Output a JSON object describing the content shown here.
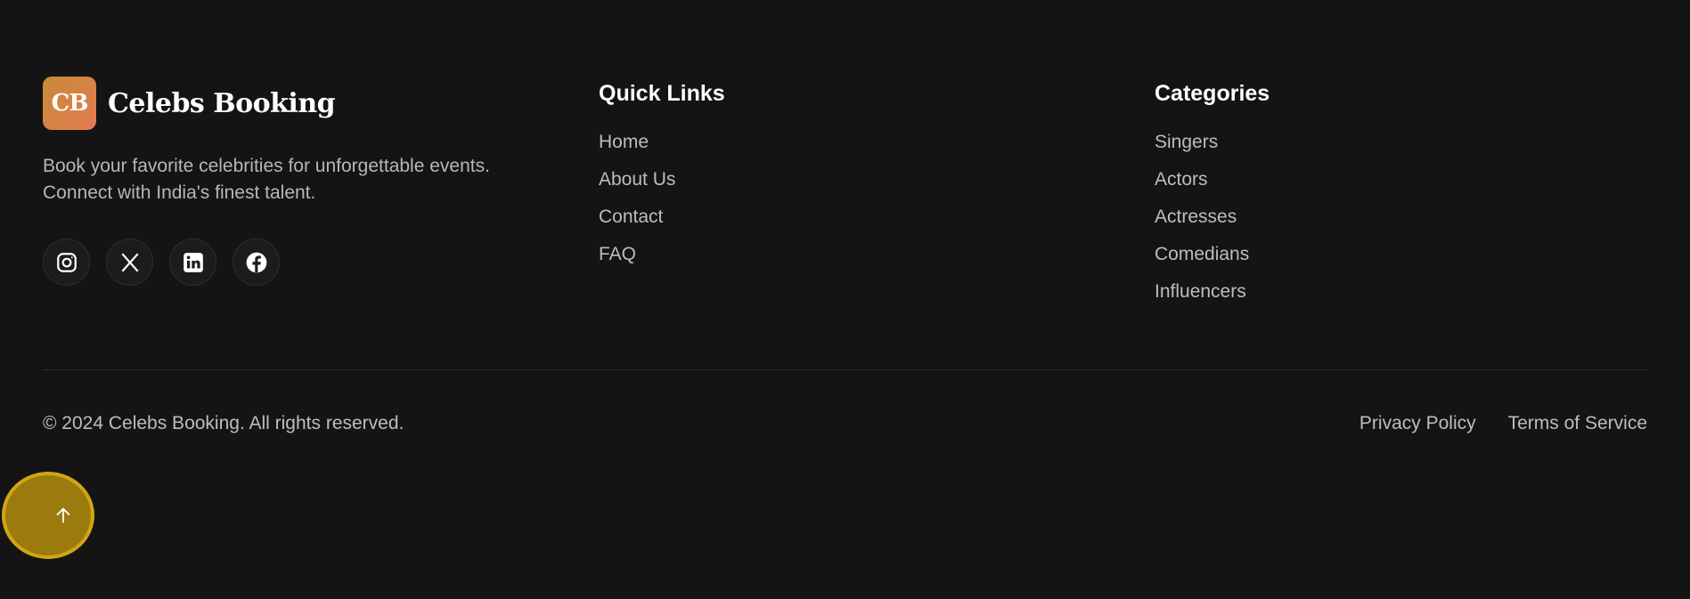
{
  "brand": {
    "logo_text": "CB",
    "name": "Celebs Booking",
    "tagline": "Book your favorite celebrities for unforgettable events. Connect with India's finest talent."
  },
  "socials": [
    {
      "icon": "instagram-icon"
    },
    {
      "icon": "x-twitter-icon"
    },
    {
      "icon": "linkedin-icon"
    },
    {
      "icon": "facebook-icon"
    }
  ],
  "quick_links": {
    "heading": "Quick Links",
    "items": [
      "Home",
      "About Us",
      "Contact",
      "FAQ"
    ]
  },
  "categories": {
    "heading": "Categories",
    "items": [
      "Singers",
      "Actors",
      "Actresses",
      "Comedians",
      "Influencers"
    ]
  },
  "bottom": {
    "copyright": "© 2024 Celebs Booking. All rights reserved.",
    "privacy": "Privacy Policy",
    "terms": "Terms of Service"
  },
  "colors": {
    "background": "#141414",
    "logo_gradient_start": "#c98a38",
    "logo_gradient_end": "#e37b52",
    "scroll_button": "#9b7a0e",
    "scroll_button_border": "#d1a514"
  },
  "scroll_top": {
    "icon": "arrow-up-icon"
  }
}
